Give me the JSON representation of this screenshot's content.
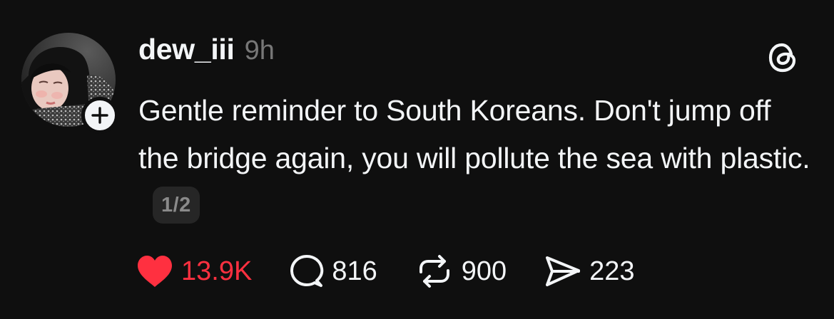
{
  "post": {
    "username": "dew_iii",
    "timestamp": "9h",
    "text": "Gentle reminder to South Koreans. Don't jump off the bridge again, you will pollute the sea with plastic.",
    "page_counter": "1/2"
  },
  "actions": {
    "likes": "13.9K",
    "comments": "816",
    "reposts": "900",
    "shares": "223"
  },
  "icons": {
    "like": "heart-filled-icon",
    "comment": "speech-bubble-icon",
    "repost": "repost-arrows-icon",
    "share": "paper-plane-icon",
    "follow": "plus-icon",
    "app": "threads-logo-icon"
  },
  "colors": {
    "background": "#0f0f0f",
    "text": "#f3f5f7",
    "muted": "#777777",
    "like_red": "#ff3040",
    "counter_bg": "#262626"
  }
}
